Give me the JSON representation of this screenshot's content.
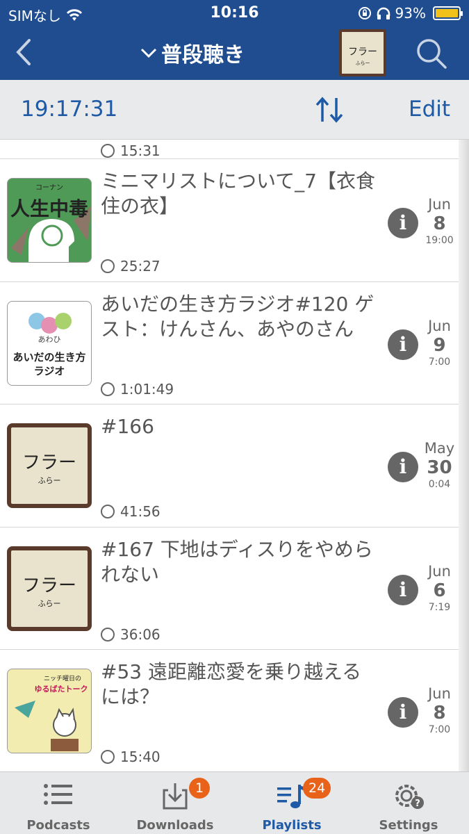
{
  "status": {
    "carrier": "SIMなし",
    "time": "10:16",
    "battery": "93%"
  },
  "nav": {
    "title": "普段聴き",
    "art_title": "フラー",
    "art_sub": "ふらー"
  },
  "toolbar": {
    "timer": "19:17:31",
    "edit_label": "Edit"
  },
  "partial_row": {
    "duration": "15:31"
  },
  "episodes": [
    {
      "title": "ミニマリストについて_7【衣食住の衣】",
      "duration": "25:27",
      "month": "Jun",
      "day": "8",
      "time": "19:00",
      "art": "人生中毒",
      "art_sub": "コーナン"
    },
    {
      "title": "あいだの生き方ラジオ#120 ゲスト：けんさん、あやのさん",
      "duration": "1:01:49",
      "month": "Jun",
      "day": "9",
      "time": "7:00",
      "art": "あいだの生き方ラジオ",
      "art_sub": "あわひ"
    },
    {
      "title": "#166",
      "duration": "41:56",
      "month": "May",
      "day": "30",
      "time": "0:04",
      "art": "フラー",
      "art_sub": "ふらー"
    },
    {
      "title": "#167 下地はディスりをやめられない",
      "duration": "36:06",
      "month": "Jun",
      "day": "6",
      "time": "7:19",
      "art": "フラー",
      "art_sub": "ふらー"
    },
    {
      "title": "#53 遠距離恋愛を乗り越えるには？",
      "duration": "15:40",
      "month": "Jun",
      "day": "8",
      "time": "7:00",
      "art": "ゆるばたトーク",
      "art_sub": "ニッチ曜日の"
    }
  ],
  "tabs": [
    {
      "label": "Podcasts",
      "badge": ""
    },
    {
      "label": "Downloads",
      "badge": "1"
    },
    {
      "label": "Playlists",
      "badge": "24"
    },
    {
      "label": "Settings",
      "badge": ""
    }
  ],
  "colors": {
    "nav_bg": "#1f4d8f",
    "accent": "#1f5aa6",
    "badge": "#e8621a"
  }
}
